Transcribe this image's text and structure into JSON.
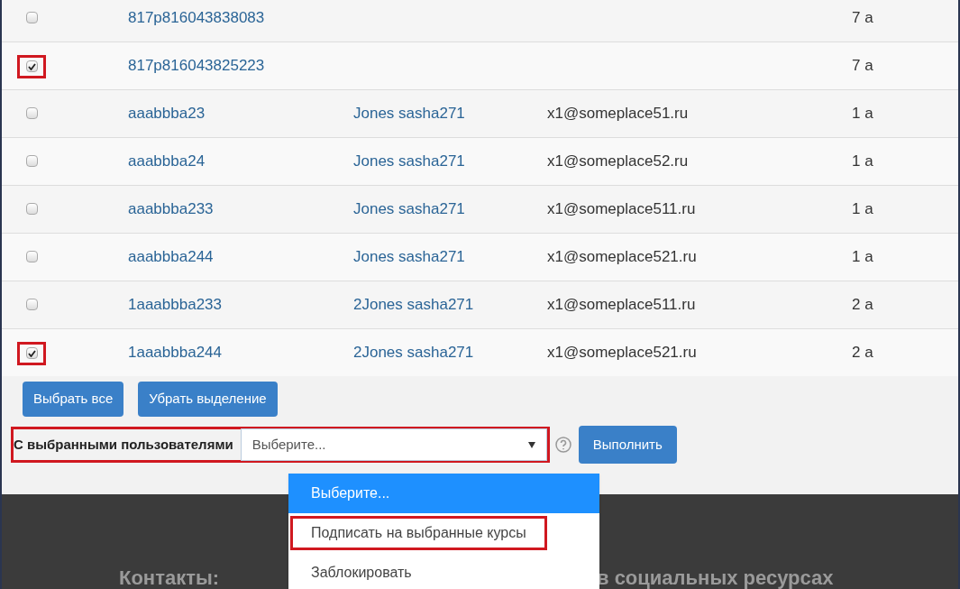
{
  "rows": [
    {
      "checked": false,
      "highlighted": false,
      "username": "817p816043838083",
      "column_3": "",
      "email": "",
      "column_5": "7 a"
    },
    {
      "checked": true,
      "highlighted": true,
      "username": "817p816043825223",
      "column_3": "",
      "email": "",
      "column_5": "7 a"
    },
    {
      "checked": false,
      "highlighted": false,
      "username": "aaabbba23",
      "column_3": "Jones sasha271",
      "email": "x1@someplace51.ru",
      "column_5": "1 a"
    },
    {
      "checked": false,
      "highlighted": false,
      "username": "aaabbba24",
      "column_3": "Jones sasha271",
      "email": "x1@someplace52.ru",
      "column_5": "1 a"
    },
    {
      "checked": false,
      "highlighted": false,
      "username": "aaabbba233",
      "column_3": "Jones sasha271",
      "email": "x1@someplace511.ru",
      "column_5": "1 a"
    },
    {
      "checked": false,
      "highlighted": false,
      "username": "aaabbba244",
      "column_3": "Jones sasha271",
      "email": "x1@someplace521.ru",
      "column_5": "1 a"
    },
    {
      "checked": false,
      "highlighted": false,
      "username": "1aaabbba233",
      "column_3": "2Jones sasha271",
      "email": "x1@someplace511.ru",
      "column_5": "2 a"
    },
    {
      "checked": true,
      "highlighted": true,
      "username": "1aaabbba244",
      "column_3": "2Jones sasha271",
      "email": "x1@someplace521.ru",
      "column_5": "2 a"
    }
  ],
  "buttons": [
    "Выбрать все",
    "Убрать выделение"
  ],
  "bulk_action": {
    "label": "С выбранными пользователями",
    "highlighted": true,
    "select_value": "Выберите...",
    "submit": "Выполнить",
    "options": [
      {
        "label": "Выберите...",
        "selected": true,
        "highlighted": false
      },
      {
        "label": "Подписать на выбранные курсы",
        "selected": false,
        "highlighted": true
      },
      {
        "label": "Заблокировать",
        "selected": false,
        "highlighted": false
      }
    ]
  },
  "footer": {
    "headings": [
      "Контакты:",
      "в социальных ресурсах"
    ]
  }
}
